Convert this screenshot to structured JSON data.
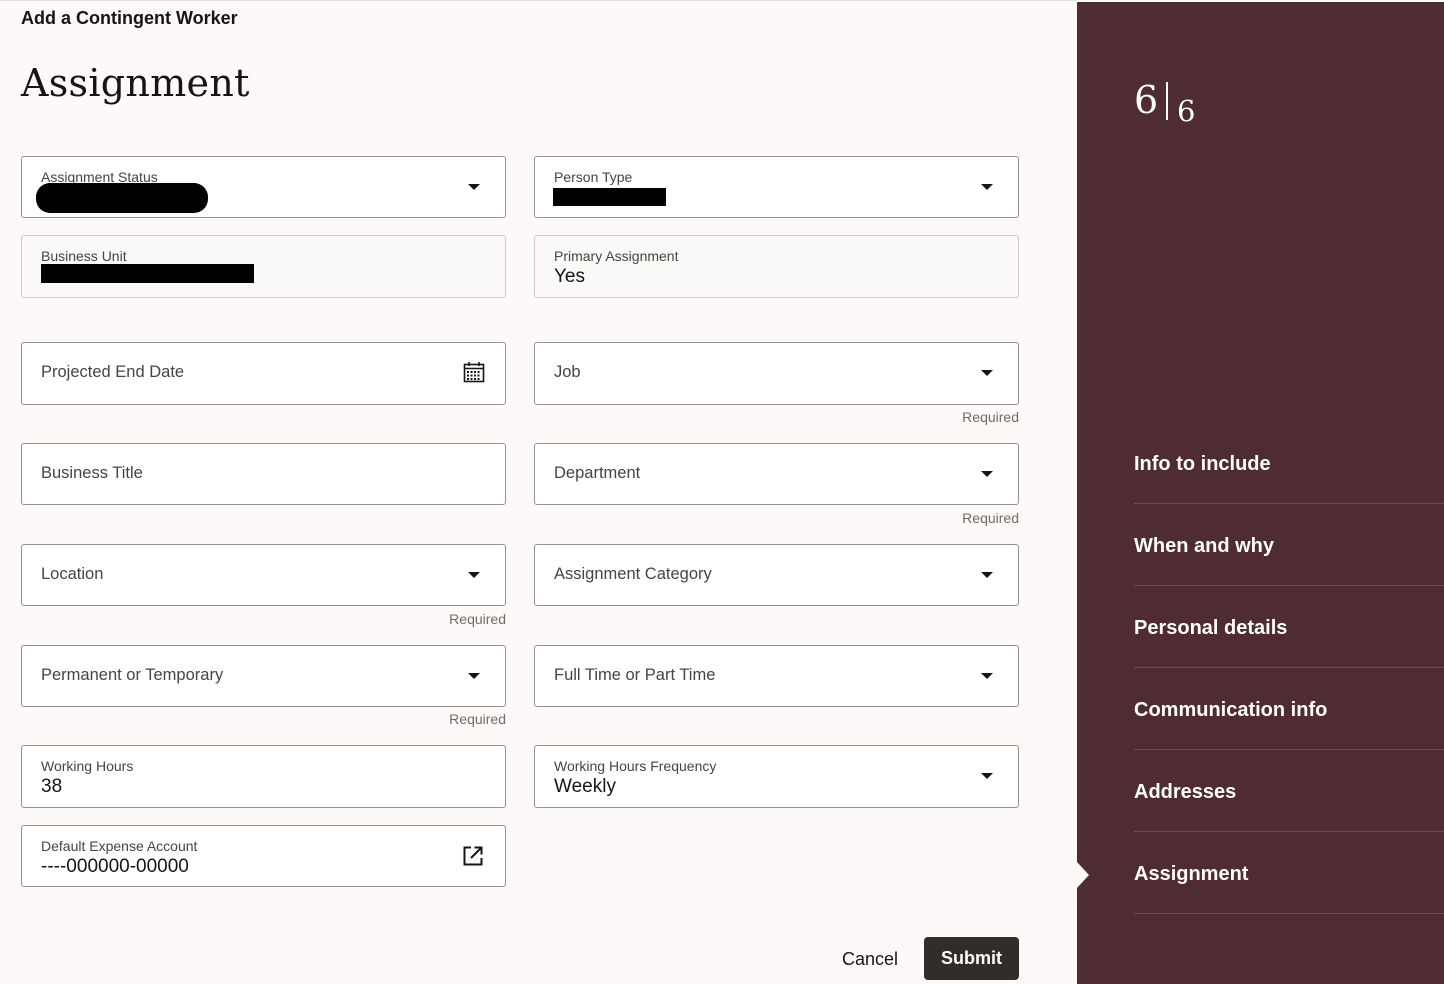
{
  "header": {
    "breadcrumb": "Add a Contingent Worker",
    "title": "Assignment"
  },
  "fields": {
    "assignment_status": {
      "label": "Assignment Status",
      "value": ""
    },
    "person_type": {
      "label": "Person Type",
      "value": ""
    },
    "business_unit": {
      "label": "Business Unit",
      "value": ""
    },
    "primary_assignment": {
      "label": "Primary Assignment",
      "value": "Yes"
    },
    "projected_end_date": {
      "label": "Projected End Date"
    },
    "job": {
      "label": "Job",
      "required": "Required"
    },
    "business_title": {
      "label": "Business Title"
    },
    "department": {
      "label": "Department",
      "required": "Required"
    },
    "location": {
      "label": "Location",
      "required": "Required"
    },
    "assignment_category": {
      "label": "Assignment Category"
    },
    "permanent_or_temporary": {
      "label": "Permanent or Temporary",
      "required": "Required"
    },
    "full_or_part_time": {
      "label": "Full Time or Part Time"
    },
    "working_hours": {
      "label": "Working Hours",
      "value": "38"
    },
    "working_hours_frequency": {
      "label": "Working Hours Frequency",
      "value": "Weekly"
    },
    "default_expense_account": {
      "label": "Default Expense Account",
      "value": "----000000-00000"
    }
  },
  "actions": {
    "cancel": "Cancel",
    "submit": "Submit"
  },
  "sidebar": {
    "step_current": "6",
    "step_total": "6",
    "items": [
      {
        "label": "Info to include"
      },
      {
        "label": "When and why"
      },
      {
        "label": "Personal details"
      },
      {
        "label": "Communication info"
      },
      {
        "label": "Addresses"
      },
      {
        "label": "Assignment",
        "active": true
      }
    ]
  },
  "colors": {
    "sidebar_bg": "#4f2b32",
    "primary_button": "#312d2a",
    "page_bg": "#fcf9f8"
  },
  "icons": {
    "projected_end_date": "calendar-icon",
    "default_expense_account": "external-link-icon",
    "dropdowns": "caret-down-icon"
  }
}
